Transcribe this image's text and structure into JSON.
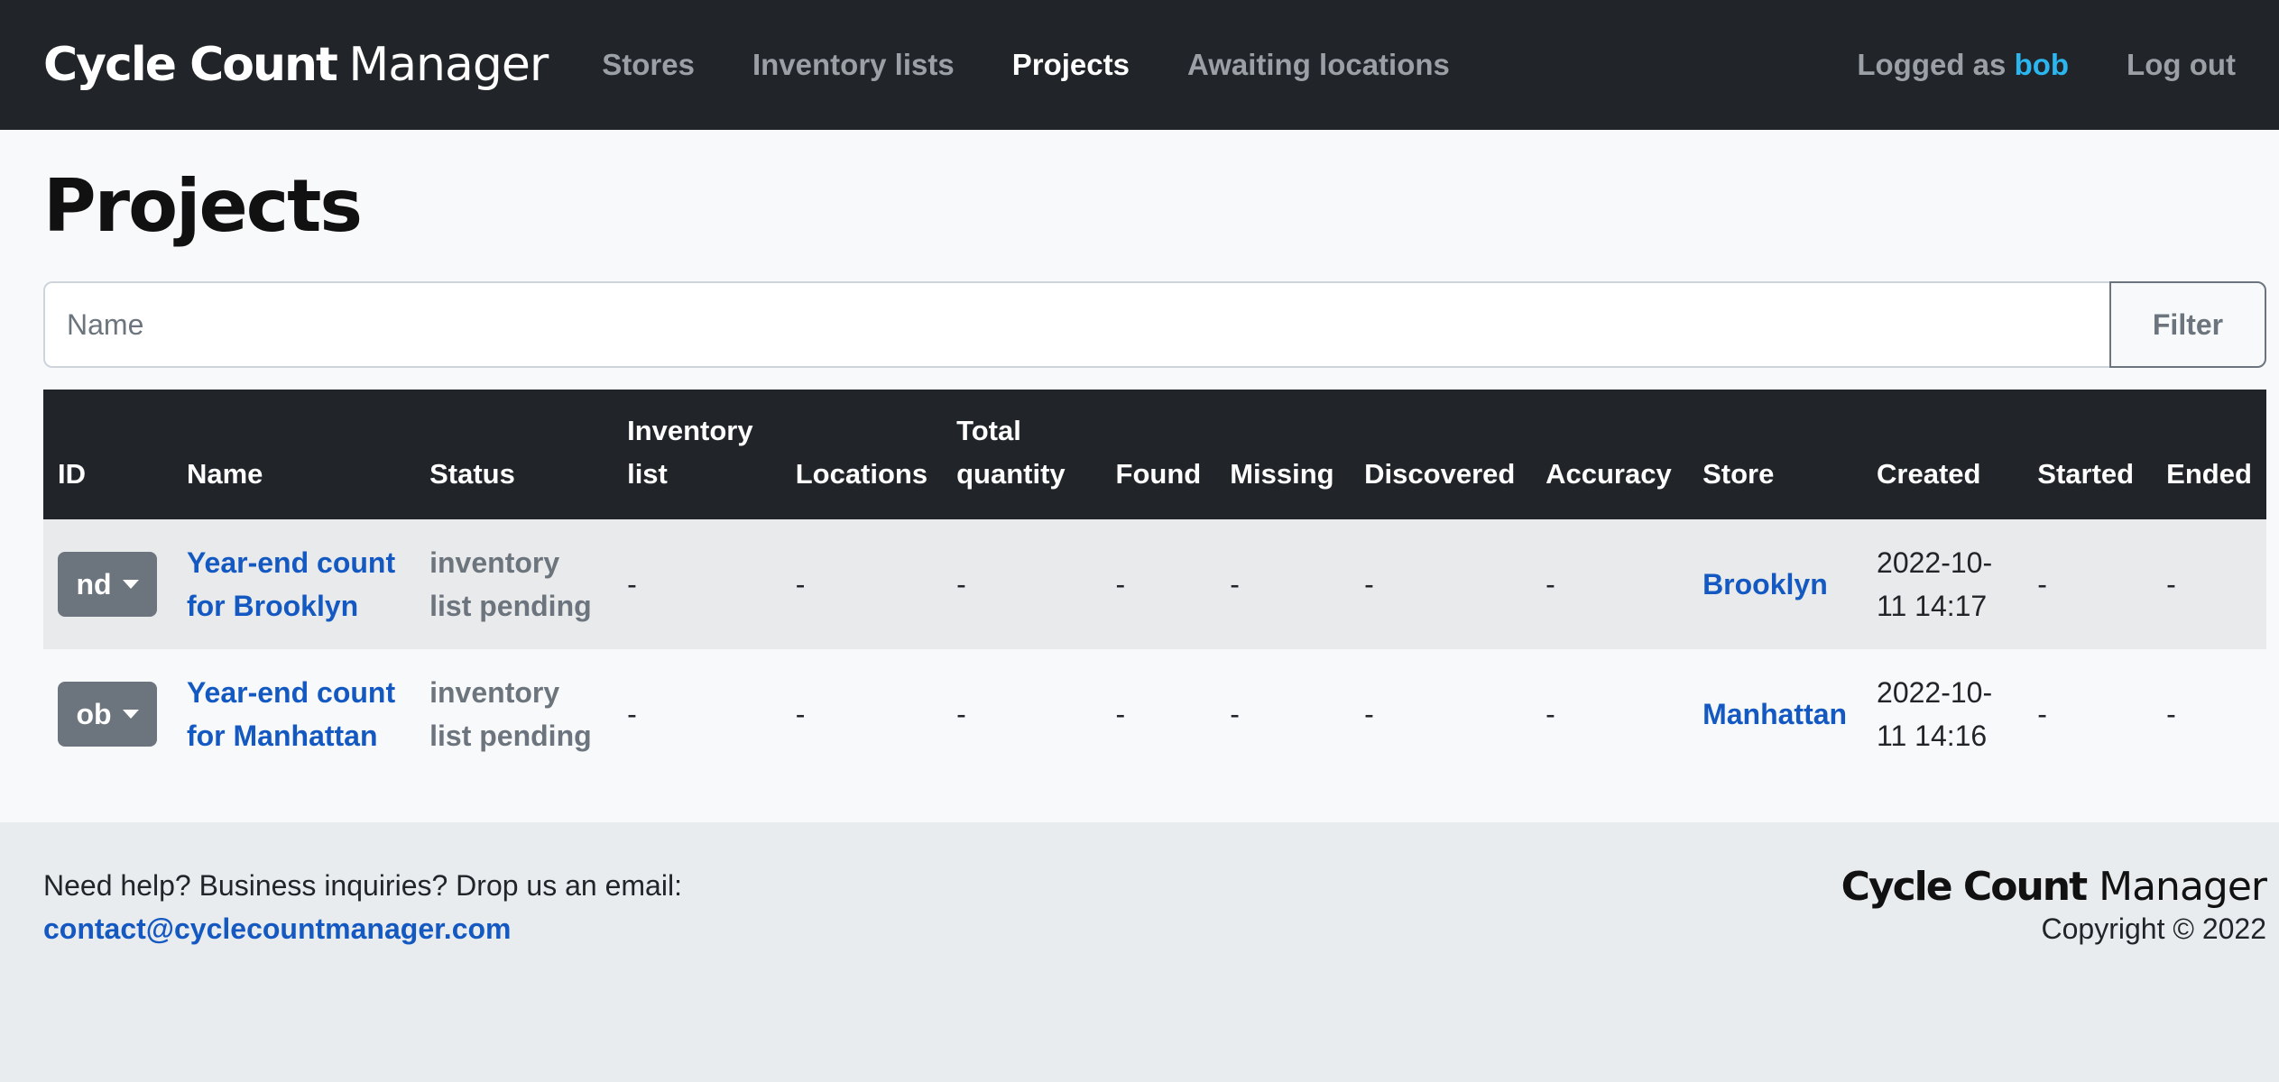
{
  "nav": {
    "brand_bold": "Cycle Count",
    "brand_light": "Manager",
    "links": [
      {
        "label": "Stores",
        "active": false
      },
      {
        "label": "Inventory lists",
        "active": false
      },
      {
        "label": "Projects",
        "active": true
      },
      {
        "label": "Awaiting locations",
        "active": false
      }
    ],
    "logged_prefix": "Logged as",
    "username": "bob",
    "logout": "Log out"
  },
  "page": {
    "title": "Projects"
  },
  "filter": {
    "placeholder": "Name",
    "value": "",
    "button": "Filter"
  },
  "table": {
    "headers": [
      "ID",
      "Name",
      "Status",
      "Inventory list",
      "Locations",
      "Total quantity",
      "Found",
      "Missing",
      "Discovered",
      "Accuracy",
      "Store",
      "Created",
      "Started",
      "Ended"
    ],
    "rows": [
      {
        "id": "nd",
        "name": "Year-end count for Brooklyn",
        "status": "inventory list pending",
        "inventory_list": "-",
        "locations": "-",
        "total_quantity": "-",
        "found": "-",
        "missing": "-",
        "discovered": "-",
        "accuracy": "-",
        "store": "Brooklyn",
        "created": "2022-10-11 14:17",
        "started": "-",
        "ended": "-"
      },
      {
        "id": "ob",
        "name": "Year-end count for Manhattan",
        "status": "inventory list pending",
        "inventory_list": "-",
        "locations": "-",
        "total_quantity": "-",
        "found": "-",
        "missing": "-",
        "discovered": "-",
        "accuracy": "-",
        "store": "Manhattan",
        "created": "2022-10-11 14:16",
        "started": "-",
        "ended": "-"
      }
    ]
  },
  "footer": {
    "help": "Need help? Business inquiries? Drop us an email:",
    "email": "contact@cyclecountmanager.com",
    "brand_bold": "Cycle Count",
    "brand_light": "Manager",
    "copyright": "Copyright © 2022"
  }
}
